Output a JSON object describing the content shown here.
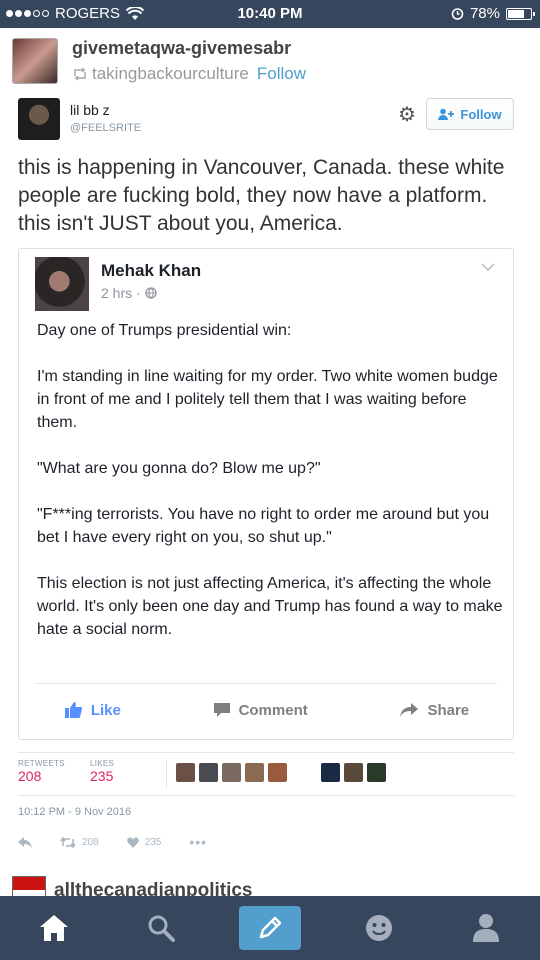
{
  "status": {
    "carrier": "ROGERS",
    "time": "10:40 PM",
    "battery": "78%",
    "battery_level": 0.78
  },
  "post": {
    "blog_name": "givemetaqwa-givemesabr",
    "reblogged_from": "takingbackourculture",
    "follow_label": "Follow"
  },
  "tweet": {
    "name": "lil bb z",
    "handle": "@FEELSRITE",
    "follow_label": "Follow",
    "text": "this is happening in Vancouver, Canada. these white people are fucking bold, they now have a platform. this isn't JUST about you, America."
  },
  "fb_post": {
    "author": "Mehak Khan",
    "time": "2 hrs",
    "paragraphs": [
      "Day one of Trumps presidential win:",
      "I'm standing in line waiting for my order. Two white women budge in front of me and I politely tell them that I was waiting before them.",
      "\"What are you gonna do? Blow me up?\"",
      "\"F***ing terrorists. You have no right to order me around but you bet I have every right on you, so shut up.\"",
      "This election is not just affecting America, it's affecting the whole world. It's only been one day and Trump has found a way to make hate a social norm."
    ],
    "like_label": "Like",
    "comment_label": "Comment",
    "share_label": "Share"
  },
  "stats": {
    "retweets_label": "RETWEETS",
    "retweets": "208",
    "likes_label": "LIKES",
    "likes": "235",
    "date": "10:12 PM - 9 Nov 2016",
    "action_retweets": "208",
    "action_likes": "235",
    "liker_colors": [
      "#6b5048",
      "#4a4a52",
      "#7a6a60",
      "#8a6a50",
      "#9a5a40",
      "#1a2a44",
      "#5a4a3a",
      "#2a3a2a"
    ]
  },
  "next_post": {
    "blog_name": "allthecanadianpolitics"
  },
  "colors": {
    "navbar": "#36465d",
    "accent": "#529ecc",
    "like_pink": "#e0245e"
  },
  "nav": {
    "icons": [
      "home-icon",
      "search-icon",
      "compose-icon",
      "activity-icon",
      "account-icon"
    ]
  }
}
